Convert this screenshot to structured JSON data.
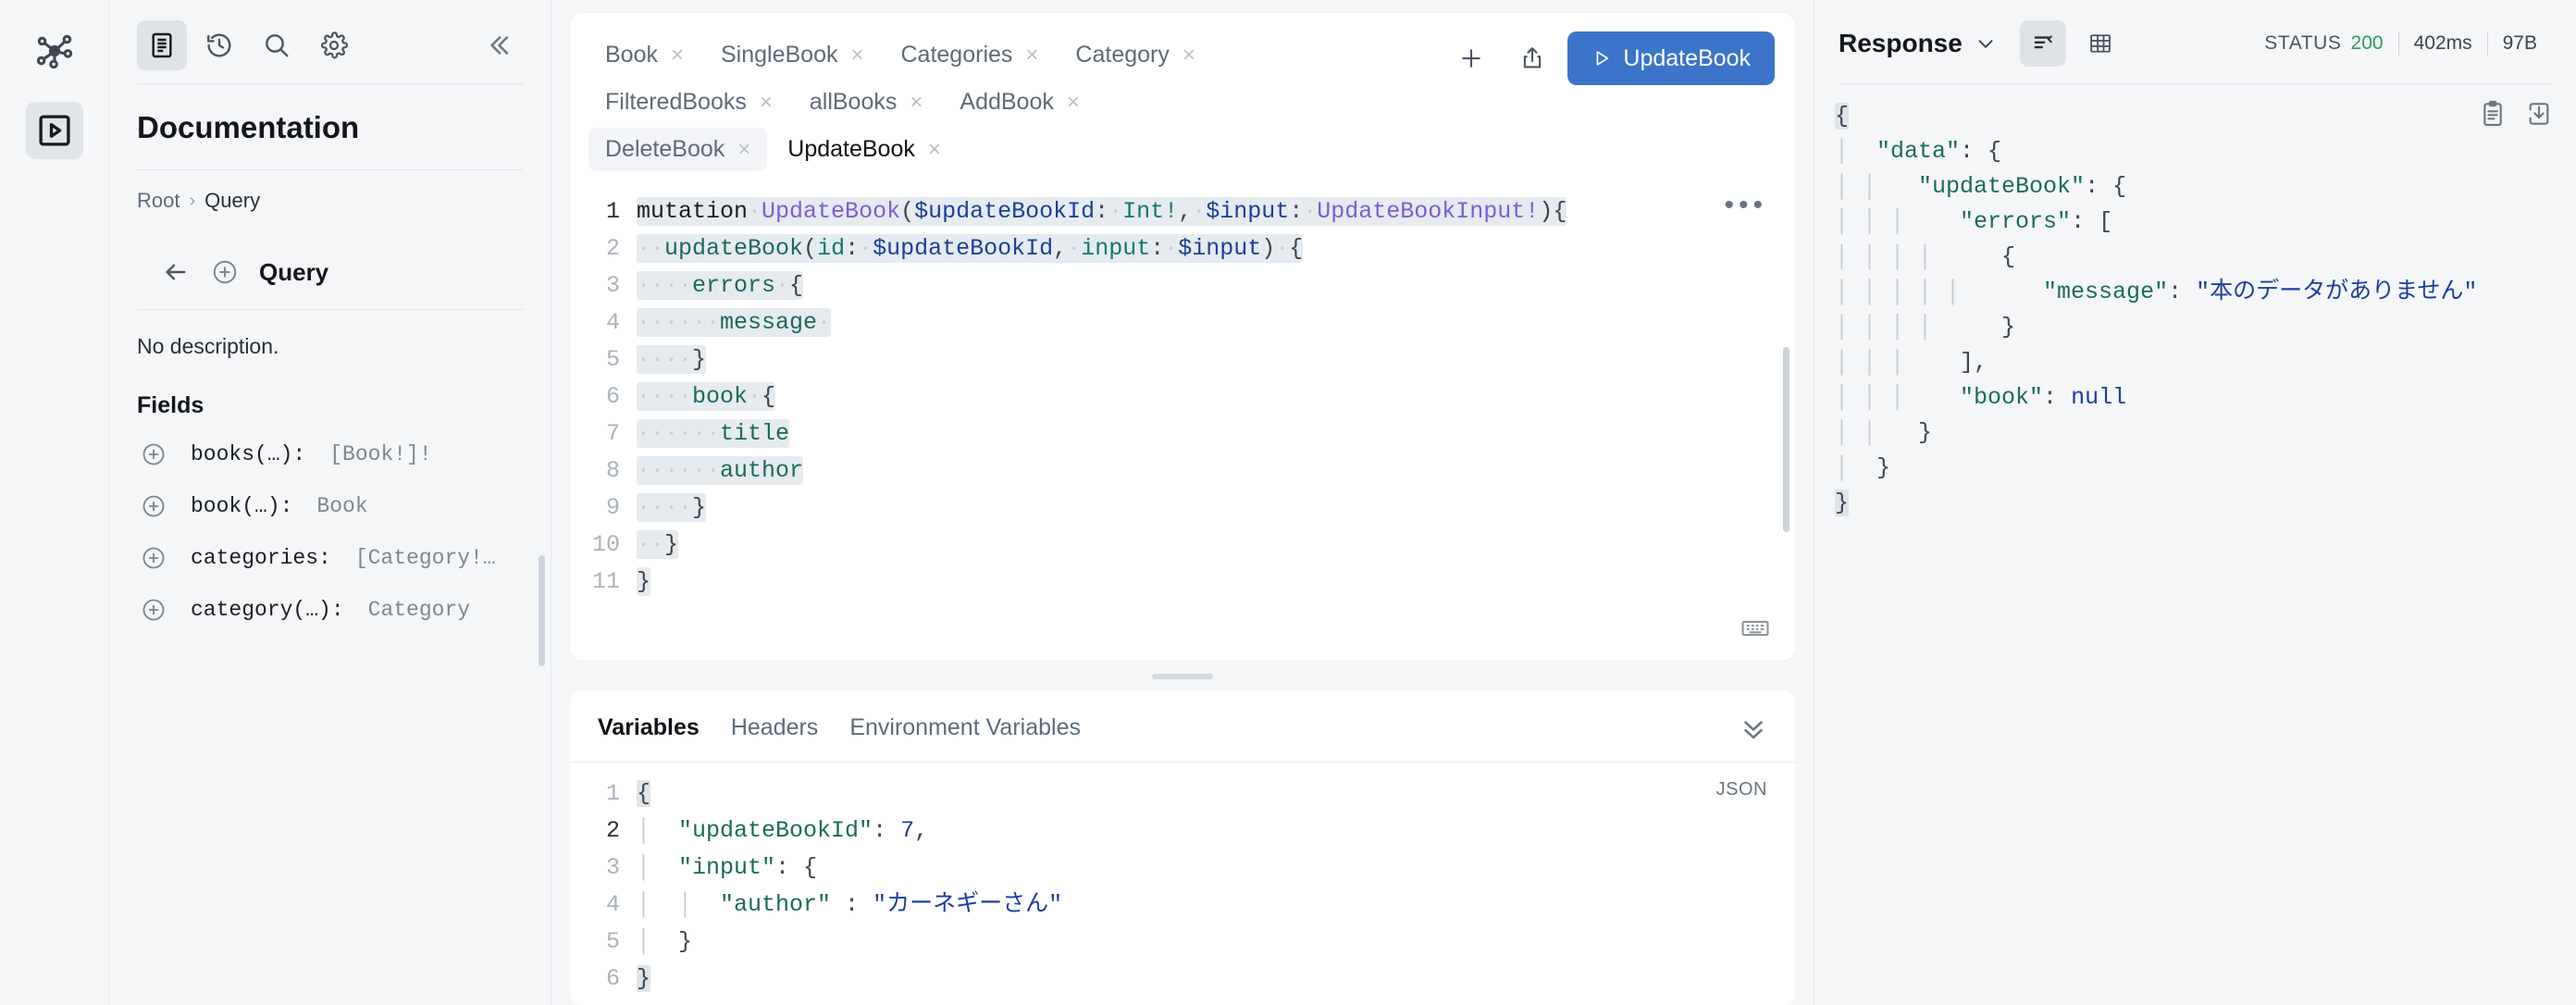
{
  "rail": {
    "logo_icon": "graph-network-icon",
    "buttons": [
      {
        "icon": "explorer-play-icon",
        "active": true
      }
    ]
  },
  "docs": {
    "toolbar": [
      {
        "icon": "documentation-icon",
        "label": "Documentation",
        "active": true
      },
      {
        "icon": "history-icon",
        "label": "History",
        "active": false
      },
      {
        "icon": "search-icon",
        "label": "Search",
        "active": false
      },
      {
        "icon": "gear-icon",
        "label": "Settings",
        "active": false
      }
    ],
    "collapse_icon": "chevron-double-left-icon",
    "title": "Documentation",
    "breadcrumb": {
      "root": "Root",
      "separator": "›",
      "current": "Query"
    },
    "type_header": {
      "back_icon": "arrow-left-icon",
      "add_icon": "plus-circle-icon",
      "name": "Query"
    },
    "description": "No description.",
    "fields_heading": "Fields",
    "fields": [
      {
        "icon": "plus-circle-icon",
        "name": "books(…):",
        "type": "[Book!]!"
      },
      {
        "icon": "plus-circle-icon",
        "name": "book(…):",
        "type": "Book"
      },
      {
        "icon": "plus-circle-icon",
        "name": "categories:",
        "type": "[Category!…"
      },
      {
        "icon": "plus-circle-icon",
        "name": "category(…):",
        "type": "Category"
      }
    ]
  },
  "editor": {
    "tabs": [
      {
        "label": "Book",
        "active": false,
        "hover": false
      },
      {
        "label": "SingleBook",
        "active": false,
        "hover": false
      },
      {
        "label": "Categories",
        "active": false,
        "hover": false
      },
      {
        "label": "Category",
        "active": false,
        "hover": false
      },
      {
        "label": "FilteredBooks",
        "active": false,
        "hover": false
      },
      {
        "label": "allBooks",
        "active": false,
        "hover": false
      },
      {
        "label": "AddBook",
        "active": false,
        "hover": false
      },
      {
        "label": "DeleteBook",
        "active": false,
        "hover": true
      },
      {
        "label": "UpdateBook",
        "active": true,
        "hover": false
      }
    ],
    "tab_close_glyph": "×",
    "add_tab_icon": "plus-icon",
    "share_icon": "share-upload-icon",
    "run_button": {
      "icon": "play-icon",
      "label": "UpdateBook"
    },
    "more_icon": "ellipsis-icon",
    "keyboard_icon": "keyboard-icon",
    "lines": [
      {
        "n": "1",
        "cur": true
      },
      {
        "n": "2",
        "cur": false
      },
      {
        "n": "3",
        "cur": false
      },
      {
        "n": "4",
        "cur": false
      },
      {
        "n": "5",
        "cur": false
      },
      {
        "n": "6",
        "cur": false
      },
      {
        "n": "7",
        "cur": false
      },
      {
        "n": "8",
        "cur": false
      },
      {
        "n": "9",
        "cur": false
      },
      {
        "n": "10",
        "cur": false
      },
      {
        "n": "11",
        "cur": false
      }
    ],
    "code_text": [
      "mutation UpdateBook($updateBookId: Int!, $input: UpdateBookInput!){",
      "  updateBook(id: $updateBookId, input: $input) {",
      "    errors {",
      "      message",
      "    }",
      "    book {",
      "      title",
      "      author",
      "    }",
      "  }",
      "}"
    ]
  },
  "variables_panel": {
    "tabs": [
      {
        "label": "Variables",
        "active": true
      },
      {
        "label": "Headers",
        "active": false
      },
      {
        "label": "Environment Variables",
        "active": false
      }
    ],
    "collapse_icon": "chevron-double-down-icon",
    "format_badge": "JSON",
    "lines": [
      {
        "n": "1",
        "cur": false
      },
      {
        "n": "2",
        "cur": true
      },
      {
        "n": "3",
        "cur": false
      },
      {
        "n": "4",
        "cur": false
      },
      {
        "n": "5",
        "cur": false
      },
      {
        "n": "6",
        "cur": false
      }
    ],
    "code_text": [
      "{",
      "  \"updateBookId\": 7,",
      "  \"input\": {",
      "    \"author\" : \"カーネギーさん\"",
      "  }",
      "}"
    ]
  },
  "response_panel": {
    "title": "Response",
    "title_chevron_icon": "chevron-down-icon",
    "view_buttons": [
      {
        "icon": "json-view-icon",
        "active": true
      },
      {
        "icon": "table-view-icon",
        "active": false
      }
    ],
    "status_label": "STATUS",
    "status_code": "200",
    "status_color": "#2e9e5b",
    "time": "402ms",
    "size": "97B",
    "copy_icon": "clipboard-copy-icon",
    "download_icon": "download-icon",
    "code_text": [
      "{",
      "  \"data\": {",
      "    \"updateBook\": {",
      "      \"errors\": [",
      "        {",
      "          \"message\": \"本のデータがありません\"",
      "        }",
      "      ],",
      "      \"book\": null",
      "    }",
      "  }",
      "}"
    ]
  },
  "colors": {
    "accent": "#3b74c9",
    "app_bg": "#f4f6f8",
    "panel_bg": "#ffffff",
    "status_ok": "#2e9e5b",
    "keyword_purple": "#7c5cd6",
    "keyword_teal": "#0b7a6e",
    "keyword_blue": "#1b3f9c"
  }
}
